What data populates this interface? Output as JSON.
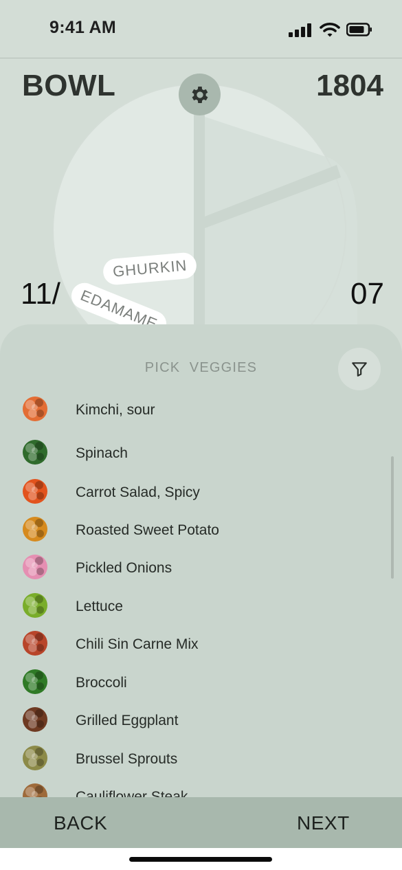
{
  "status_bar": {
    "time": "9:41 AM",
    "icons": [
      "signal-icon",
      "wifi-icon",
      "battery-icon"
    ]
  },
  "header": {
    "title": "BOWL",
    "number": "1804",
    "settings_icon": "gear-icon"
  },
  "bowl": {
    "left_number": "11/",
    "right_number": "07",
    "chips": [
      "GHURKIN",
      "EDAMAME"
    ]
  },
  "sheet": {
    "title": "PICK  VEGGIES",
    "filter_icon": "filter-icon",
    "items": [
      {
        "label": "Kimchi, sour",
        "color": "#e36d34"
      },
      {
        "label": "Spinach",
        "color": "#2f6b2c"
      },
      {
        "label": "Carrot Salad, Spicy",
        "color": "#e2531d"
      },
      {
        "label": "Roasted Sweet Potato",
        "color": "#d68a1e"
      },
      {
        "label": "Pickled Onions",
        "color": "#e58fb2"
      },
      {
        "label": "Lettuce",
        "color": "#79ad2a"
      },
      {
        "label": "Chili Sin Carne Mix",
        "color": "#b8452a"
      },
      {
        "label": "Broccoli",
        "color": "#2f7a26"
      },
      {
        "label": "Grilled Eggplant",
        "color": "#6e3a22"
      },
      {
        "label": "Brussel Sprouts",
        "color": "#8c8a48"
      },
      {
        "label": "Cauliflower Steak",
        "color": "#9e6a3a"
      }
    ]
  },
  "footer": {
    "back_label": "BACK",
    "next_label": "NEXT"
  },
  "colors": {
    "accent": "#a8b8ad",
    "background": "#d3ddd6",
    "sheet": "#c9d5cd"
  }
}
